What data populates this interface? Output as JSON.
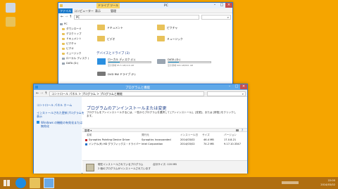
{
  "explorer": {
    "title": "PC",
    "manage_tab": "ドライブ ツール",
    "tabs": [
      "ファイル",
      "コンピューター",
      "表示",
      "管理"
    ],
    "address": "PC",
    "nav": [
      "PC",
      "ダウンロード",
      "デスクトップ",
      "ドキュメント",
      "ピクチャ",
      "ビデオ",
      "ミュージック",
      "ローカル ディスク (",
      "DATA (D:)"
    ],
    "folders": [
      "ドキュメント",
      "ピクチャ",
      "ビデオ",
      "ミュージック"
    ],
    "section": "デバイスとドライブ (3)",
    "drives": [
      {
        "name": "ローカル ディスク (C:)",
        "info": "空き領域 85.5 GB/116 GB",
        "used": 0.26
      },
      {
        "name": "DATA (D:)",
        "info": "空き領域 604 GB/801 GB",
        "used": 0.25
      },
      {
        "name": "DVD RW ドライブ (F:)",
        "info": "",
        "used": null
      }
    ]
  },
  "programs": {
    "title": "プログラムと機能",
    "breadcrumb": "コントロール パネル > プログラム > プログラムと機能",
    "left_links": [
      "コントロール パネル ホーム",
      "インストールされた更新プログラムを",
      "表示",
      "Windows の機能の有効化または",
      "無効化"
    ],
    "heading": "プログラムのアンインストールまたは変更",
    "description": [
      "プログラムをアンインストールするには、一覧からプログラムを選択して [アンインストール]、[変更]、または [修復] をクリックし",
      "ます。"
    ],
    "toolbar_label": "整理 ▾",
    "columns": [
      "名前",
      "発行元",
      "インストール日",
      "サイズ",
      "バージョン"
    ],
    "rows": [
      {
        "name": "Synaptics Pointing Device Driver",
        "publisher": "Synaptics Incorporated",
        "date": "2014/03/02",
        "size": "46.4 MB",
        "version": "17.0.8.21"
      },
      {
        "name": "インテル(R) HD グラフィックス・ドライバー",
        "publisher": "Intel Corporation",
        "date": "2014/03/02",
        "size": "74.2 MB",
        "version": "9.17.10.3347"
      }
    ],
    "footer_line1": "現在インストールされているプログラム",
    "footer_total": "合計サイズ: 120 MB",
    "footer_line2": "2 個のプログラムがインストールされています"
  },
  "taskbar": {
    "time": "22:00",
    "date": "2014/03/02"
  },
  "colors": {
    "desktop": "#f5a500",
    "accent": "#2b78d4",
    "taskbar": "#b06e10"
  }
}
